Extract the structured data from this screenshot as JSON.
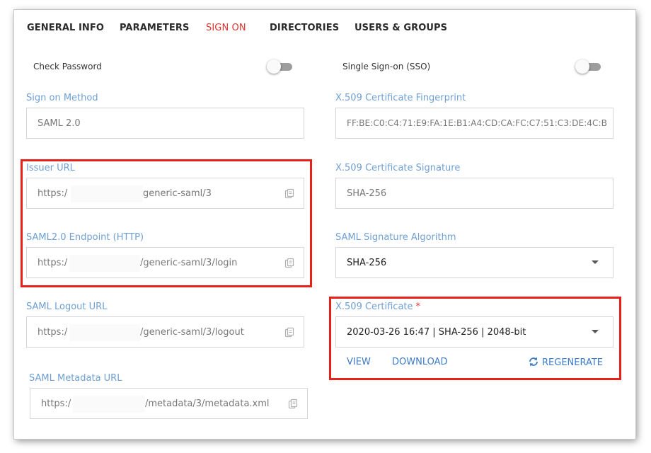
{
  "tabs": [
    {
      "label": "GENERAL INFO",
      "active": false
    },
    {
      "label": "PARAMETERS",
      "active": false
    },
    {
      "label": "SIGN ON",
      "active": true
    },
    {
      "label": "DIRECTORIES",
      "active": false
    },
    {
      "label": "USERS & GROUPS",
      "active": false
    }
  ],
  "toggles": {
    "check_password": {
      "label": "Check Password",
      "on": false
    },
    "sso": {
      "label": "Single Sign-on (SSO)",
      "on": false
    }
  },
  "left": {
    "sign_on_method": {
      "label": "Sign on Method",
      "value": "SAML 2.0"
    },
    "issuer_url": {
      "label": "Issuer URL",
      "prefix": "https:/",
      "suffix": "generic-saml/3"
    },
    "saml_endpoint": {
      "label": "SAML2.0 Endpoint (HTTP)",
      "prefix": "https:/",
      "suffix": "/generic-saml/3/login"
    },
    "logout_url": {
      "label": "SAML Logout URL",
      "prefix": "https:/",
      "suffix": "/generic-saml/3/logout"
    },
    "metadata_url": {
      "label": "SAML Metadata URL",
      "prefix": "https:/",
      "suffix": "/metadata/3/metadata.xml"
    }
  },
  "right": {
    "fingerprint": {
      "label": "X.509 Certificate Fingerprint",
      "value": "FF:BE:C0:C4:71:E9:FA:1E:B1:A4:CD:CA:FC:C7:51:C3:DE:4C:B"
    },
    "signature": {
      "label": "X.509 Certificate Signature",
      "value": "SHA-256"
    },
    "algorithm": {
      "label": "SAML Signature Algorithm",
      "value": "SHA-256"
    },
    "certificate": {
      "label": "X.509 Certificate",
      "required_mark": "*",
      "value": "2020-03-26 16:47 | SHA-256 | 2048-bit"
    }
  },
  "cert_actions": {
    "view": "VIEW",
    "download": "DOWNLOAD",
    "regenerate": "REGENERATE"
  },
  "colors": {
    "accent_red": "#e2332f",
    "label_blue": "#6f9fd3",
    "link_blue": "#3d7cc9",
    "highlight_red": "#e8201a"
  },
  "icons": [
    "copy-icon",
    "chevron-down-icon",
    "refresh-icon"
  ]
}
